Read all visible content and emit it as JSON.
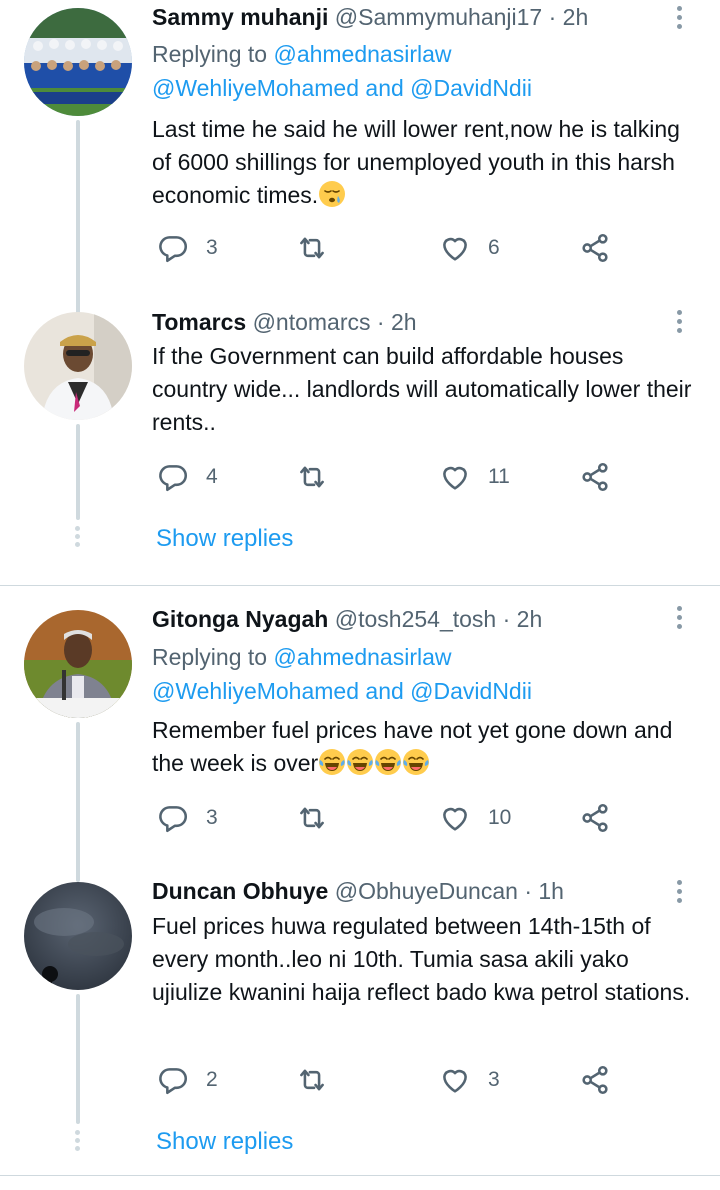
{
  "threads": [
    {
      "tweets": [
        {
          "name": "Sammy muhanji",
          "handle": "@Sammymuhanji17",
          "dot": "·",
          "time": "2h",
          "replying_prefix": "Replying to ",
          "replying_first": "@ahmednasirlaw",
          "replying_second": "@WehliyeMohamed",
          "replying_and": " and ",
          "replying_third": "@DavidNdii",
          "text": "Last time he said he will lower rent,now he is talking of 6000 shillings for unemployed youth in this harsh economic times.",
          "replies": "3",
          "likes": "6"
        },
        {
          "name": "Tomarcs",
          "handle": "@ntomarcs",
          "dot": "·",
          "time": "2h",
          "text": "If the Government can  build affordable houses country wide... landlords will automatically lower their rents..",
          "replies": "4",
          "likes": "11"
        }
      ],
      "show_replies": "Show replies"
    },
    {
      "tweets": [
        {
          "name": "Gitonga Nyagah",
          "handle": "@tosh254_tosh",
          "dot": "·",
          "time": "2h",
          "replying_prefix": "Replying to ",
          "replying_first": "@ahmednasirlaw",
          "replying_second": "@WehliyeMohamed",
          "replying_and": " and ",
          "replying_third": "@DavidNdii",
          "text": "Remember fuel prices have not yet gone down and the week is over",
          "replies": "3",
          "likes": "10"
        },
        {
          "name": "Duncan Obhuye",
          "handle": "@ObhuyeDuncan",
          "dot": "·",
          "time": "1h",
          "text": "Fuel prices huwa regulated between 14th-15th of every month..leo ni 10th. Tumia sasa akili yako ujiulize kwanini haija reflect bado kwa petrol stations.",
          "replies": "2",
          "likes": "3"
        }
      ],
      "show_replies": "Show replies"
    }
  ],
  "icons": {
    "reply": "reply-icon",
    "retweet": "retweet-icon",
    "like": "heart-icon",
    "share": "share-icon",
    "more": "more-dots-icon",
    "emoji_sleepy": "sleepy-face-emoji",
    "emoji_laugh": "tears-of-joy-emoji"
  },
  "colors": {
    "link": "#1d9bf0",
    "secondary_text": "#536471",
    "thread_line": "#cfd9de"
  }
}
